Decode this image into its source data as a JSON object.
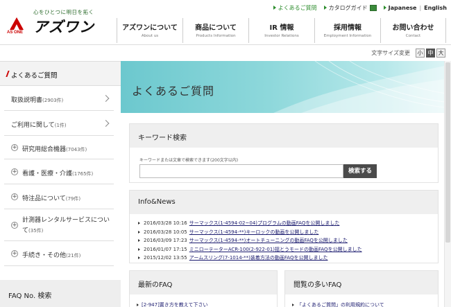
{
  "header": {
    "tagline": "心をひとつに明日を拓く",
    "brand": "アズワン",
    "brand_mark_text": "AS ONE",
    "util": {
      "faq": "よくあるご質問",
      "catalog": "カタログガイド",
      "lang_ja": "Japanese",
      "lang_en": "English",
      "separator": "|"
    },
    "nav": [
      {
        "ja": "アズワンについて",
        "en": "About us"
      },
      {
        "ja": "商品について",
        "en": "Products Information"
      },
      {
        "ja": "IR 情報",
        "en": "Investor Relations"
      },
      {
        "ja": "採用情報",
        "en": "Employment Information"
      },
      {
        "ja": "お問い合わせ",
        "en": "Contact"
      }
    ]
  },
  "fontsize": {
    "label": "文字サイズ変更",
    "small": "小",
    "medium": "中",
    "large": "大",
    "active": "medium"
  },
  "sidebar": {
    "title": "よくあるご質問",
    "items": [
      {
        "label": "取扱説明書",
        "count": "(2903件)"
      },
      {
        "label": "ご利用に関して",
        "count": "(1件)"
      },
      {
        "label": "研究用総合機器",
        "count": "(7043件)"
      },
      {
        "label": "看護・医療・介護",
        "count": "(1765件)"
      },
      {
        "label": "特注品について",
        "count": "(79件)"
      },
      {
        "label": "計測器レンタルサービスについて",
        "label2": "",
        "count": "(35件)"
      },
      {
        "label": "手続き・その他",
        "count": "(21件)"
      }
    ],
    "faq_no_search": "FAQ No. 検索"
  },
  "main": {
    "page_title": "よくあるご質問",
    "keyword": {
      "title": "キーワード検索",
      "note": "キーワードまたは文章で検索できます(200文字以内)",
      "input_value": "",
      "button": "検索する"
    },
    "news": {
      "title": "Info&News",
      "items": [
        {
          "date": "2016/03/28 10:16",
          "text": "サーマックス(1-4594-02~04)プログラムの動画FAQを公開しました"
        },
        {
          "date": "2016/03/28 10:05",
          "text": "サーマックス(1-4594-**)キーロックの動画を公開しました"
        },
        {
          "date": "2016/03/09 17:23",
          "text": "サーマックス(1-4594-**)オートチューニングの動画FAQを公開しました"
        },
        {
          "date": "2016/01/07 17:15",
          "text": "ミニローテーターACR-100(2-922-01)揺とうモードの動画FAQを公開しました"
        },
        {
          "date": "2015/12/02 13:55",
          "text": "アームスリング(7-1014-**)装着方法の動画FAQを公開しました"
        }
      ]
    },
    "latest_faq": {
      "title": "最新のFAQ",
      "items": [
        "[2-947]置き方を教えて下さい"
      ]
    },
    "popular_faq": {
      "title": "閲覧の多いFAQ",
      "items": [
        "「よくあるご質問」の利用規約について"
      ]
    }
  },
  "colors": {
    "accent_green": "#2c8c2c",
    "banner_teal": "#6cc8ce",
    "link_navy": "#1a1a6e",
    "sidebar_marker_red": "#cc0000"
  }
}
